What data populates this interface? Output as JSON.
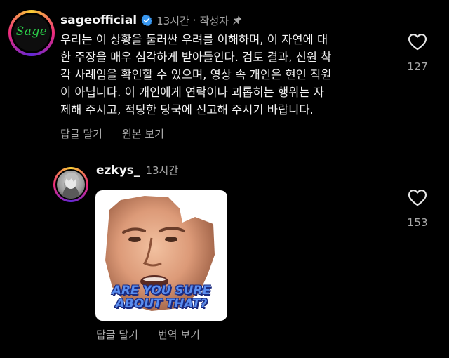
{
  "comment": {
    "username": "sageofficial",
    "avatar_logo": "Sage",
    "time": "13시간",
    "separator": "·",
    "author_badge": "작성자",
    "body_lines": [
      "우리는 이 상황을 둘러싼 우려를 이해하며, 이 자연에 대",
      "한 주장을 매우 심각하게 받아들인다. 검토 결과, 신원 착",
      "각 사례임을 확인할 수 있으며, 영상 속 개인은 현인 직원",
      "이 아닙니다. 이 개인에게 연락이나 괴롭히는 행위는 자",
      "제해 주시고, 적당한 당국에 신고해 주시기 바랍니다."
    ],
    "reply_label": "답글 달기",
    "see_original_label": "원본 보기",
    "like_count": "127",
    "icons": [
      "verified-badge-icon",
      "pin-icon",
      "heart-icon"
    ]
  },
  "reply": {
    "username": "ezkys_",
    "time": "13시간",
    "sticker_text_line1": "ARE YOU SURE",
    "sticker_text_line2": "ABOUT THAT?",
    "reply_label": "답글 달기",
    "translate_label": "번역 보기",
    "like_count": "153",
    "icons": [
      "heart-icon"
    ]
  },
  "colors": {
    "background": "#000000",
    "primary_text": "#f5f5f5",
    "secondary_text": "#a8a8a8",
    "verified_blue": "#3897f0",
    "sage_green": "#2bd24a"
  }
}
